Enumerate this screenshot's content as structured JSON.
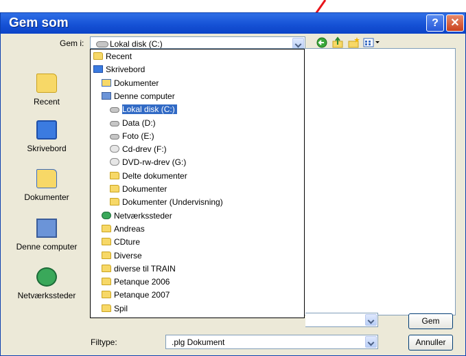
{
  "window": {
    "title": "Gem som",
    "help_label": "?",
    "close_label": "✕"
  },
  "location": {
    "label": "Gem i:",
    "value": "Lokal disk (C:)",
    "icon": "drive-icon"
  },
  "toolbar": {
    "back_icon": "back-arrow-icon",
    "up_icon": "up-folder-icon",
    "new_folder_icon": "new-folder-icon",
    "view_menu_icon": "view-menu-icon"
  },
  "places": [
    {
      "label": "Recent",
      "icon": "recent-folder-icon"
    },
    {
      "label": "Skrivebord",
      "icon": "desktop-icon"
    },
    {
      "label": "Dokumenter",
      "icon": "documents-icon"
    },
    {
      "label": "Denne computer",
      "icon": "computer-icon"
    },
    {
      "label": "Netværkssteder",
      "icon": "network-icon"
    }
  ],
  "dropdown_items": [
    {
      "label": "Recent",
      "icon": "folder",
      "indent": 0
    },
    {
      "label": "Skrivebord",
      "icon": "desktop",
      "indent": 0
    },
    {
      "label": "Dokumenter",
      "icon": "docs",
      "indent": 1
    },
    {
      "label": "Denne computer",
      "icon": "computer",
      "indent": 1
    },
    {
      "label": "Lokal disk (C:)",
      "icon": "drive",
      "indent": 2,
      "selected": true
    },
    {
      "label": "Data (D:)",
      "icon": "drive",
      "indent": 2
    },
    {
      "label": "Foto (E:)",
      "icon": "drive",
      "indent": 2
    },
    {
      "label": "Cd-drev (F:)",
      "icon": "cd",
      "indent": 2
    },
    {
      "label": "DVD-rw-drev (G:)",
      "icon": "cd",
      "indent": 2
    },
    {
      "label": "Delte dokumenter",
      "icon": "folder",
      "indent": 2
    },
    {
      "label": "Dokumenter",
      "icon": "folder",
      "indent": 2
    },
    {
      "label": "Dokumenter (Undervisning)",
      "icon": "folder",
      "indent": 2
    },
    {
      "label": "Netværkssteder",
      "icon": "network",
      "indent": 1
    },
    {
      "label": "Andreas",
      "icon": "folder",
      "indent": 1
    },
    {
      "label": "CDture",
      "icon": "folder",
      "indent": 1
    },
    {
      "label": "Diverse",
      "icon": "folder",
      "indent": 1
    },
    {
      "label": "diverse til TRAIN",
      "icon": "folder",
      "indent": 1
    },
    {
      "label": "Petanque 2006",
      "icon": "folder",
      "indent": 1
    },
    {
      "label": "Petanque 2007",
      "icon": "folder",
      "indent": 1
    },
    {
      "label": "Spil",
      "icon": "folder",
      "indent": 1
    }
  ],
  "filename": {
    "value": ""
  },
  "filetype": {
    "label": "Filtype:",
    "value": ".plg Dokument"
  },
  "buttons": {
    "save": "Gem",
    "cancel": "Annuller"
  },
  "colors": {
    "title_bar": "#1652d6",
    "selection": "#316ac5",
    "annotation_arrow": "#e8151b"
  }
}
